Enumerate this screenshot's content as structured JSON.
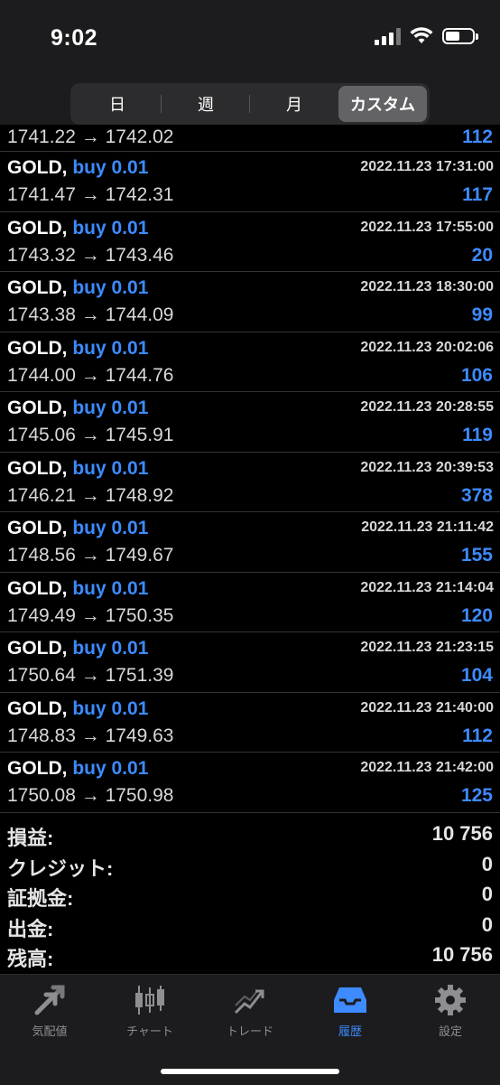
{
  "status": {
    "time": "9:02",
    "battery_level": 0.55
  },
  "period_tabs": [
    {
      "label": "日",
      "active": false
    },
    {
      "label": "週",
      "active": false
    },
    {
      "label": "月",
      "active": false
    },
    {
      "label": "カスタム",
      "active": true
    }
  ],
  "partial_trade": {
    "prices": "1741.22 → 1742.02",
    "profit": "112"
  },
  "trades": [
    {
      "symbol": "GOLD,",
      "side": "buy 0.01",
      "time": "2022.11.23 17:31:00",
      "prices": "1741.47 → 1742.31",
      "profit": "117"
    },
    {
      "symbol": "GOLD,",
      "side": "buy 0.01",
      "time": "2022.11.23 17:55:00",
      "prices": "1743.32 → 1743.46",
      "profit": "20"
    },
    {
      "symbol": "GOLD,",
      "side": "buy 0.01",
      "time": "2022.11.23 18:30:00",
      "prices": "1743.38 → 1744.09",
      "profit": "99"
    },
    {
      "symbol": "GOLD,",
      "side": "buy 0.01",
      "time": "2022.11.23 20:02:06",
      "prices": "1744.00 → 1744.76",
      "profit": "106"
    },
    {
      "symbol": "GOLD,",
      "side": "buy 0.01",
      "time": "2022.11.23 20:28:55",
      "prices": "1745.06 → 1745.91",
      "profit": "119"
    },
    {
      "symbol": "GOLD,",
      "side": "buy 0.01",
      "time": "2022.11.23 20:39:53",
      "prices": "1746.21 → 1748.92",
      "profit": "378"
    },
    {
      "symbol": "GOLD,",
      "side": "buy 0.01",
      "time": "2022.11.23 21:11:42",
      "prices": "1748.56 → 1749.67",
      "profit": "155"
    },
    {
      "symbol": "GOLD,",
      "side": "buy 0.01",
      "time": "2022.11.23 21:14:04",
      "prices": "1749.49 → 1750.35",
      "profit": "120"
    },
    {
      "symbol": "GOLD,",
      "side": "buy 0.01",
      "time": "2022.11.23 21:23:15",
      "prices": "1750.64 → 1751.39",
      "profit": "104"
    },
    {
      "symbol": "GOLD,",
      "side": "buy 0.01",
      "time": "2022.11.23 21:40:00",
      "prices": "1748.83 → 1749.63",
      "profit": "112"
    },
    {
      "symbol": "GOLD,",
      "side": "buy 0.01",
      "time": "2022.11.23 21:42:00",
      "prices": "1750.08 → 1750.98",
      "profit": "125"
    }
  ],
  "summary": [
    {
      "label": "損益:",
      "value": "10 756"
    },
    {
      "label": "クレジット:",
      "value": "0"
    },
    {
      "label": "証拠金:",
      "value": "0"
    },
    {
      "label": "出金:",
      "value": "0"
    },
    {
      "label": "残高:",
      "value": "10 756"
    }
  ],
  "tabbar": [
    {
      "label": "気配値",
      "icon": "quotes-arrows-icon",
      "active": false
    },
    {
      "label": "チャート",
      "icon": "candlestick-chart-icon",
      "active": false
    },
    {
      "label": "トレード",
      "icon": "trade-trend-icon",
      "active": false
    },
    {
      "label": "履歴",
      "icon": "history-inbox-icon",
      "active": true
    },
    {
      "label": "設定",
      "icon": "gear-icon",
      "active": false
    }
  ],
  "colors": {
    "accent": "#3d8bff",
    "background": "#000000",
    "bar": "#1c1c1e"
  }
}
